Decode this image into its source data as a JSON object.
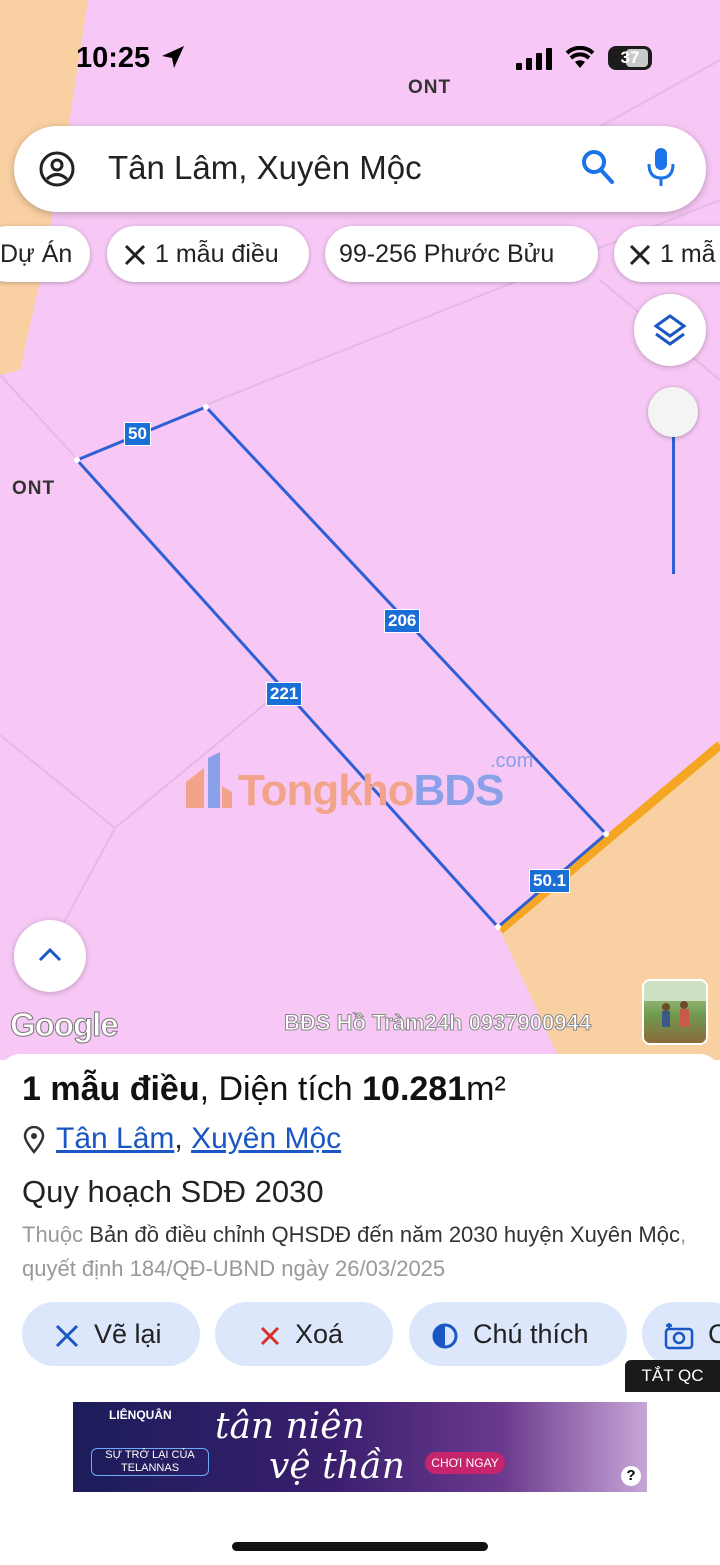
{
  "status_bar": {
    "time": "10:25",
    "battery": "37"
  },
  "map": {
    "zone_labels": [
      "ONT",
      "ONT"
    ],
    "search": {
      "query": "Tân Lâm, Xuyên Mộc"
    },
    "chips": [
      "Dự Án",
      "1 mẫu điều",
      "99-256 Phước Bửu",
      "1 mẫ"
    ],
    "edge_labels": [
      "50",
      "206",
      "221",
      "50.1"
    ],
    "watermark": {
      "text_a": "Tongkho",
      "text_b": "BDS",
      "suffix": ".com"
    },
    "google_logo": "Google",
    "overlay_text": "BĐS Hồ Tràm24h 0937900944",
    "colors": {
      "land_pink": "#f7c8f5",
      "land_orange": "#f9d0a2",
      "boundary": "#2f5fd4",
      "road": "#f5a623"
    }
  },
  "sheet": {
    "title_a": "1 mẫu điều",
    "title_b": ", Diện tích ",
    "title_area": "10.281",
    "title_unit": "m²",
    "location_a": "Tân Lâm",
    "location_sep": ",",
    "location_b": "Xuyên Mộc",
    "plan_title": "Quy hoạch SDĐ 2030",
    "desc_prefix": "Thuộc",
    "desc_main": "Bản đồ điều chỉnh QHSDĐ đến năm 2030 huyện Xuyên Mộc",
    "desc_suffix": ", quyết định 184/QĐ-UBND ngày 26/03/2025",
    "actions": [
      "Vẽ lại",
      "Xoá",
      "Chú thích",
      "C"
    ]
  },
  "ad": {
    "close_label": "TẮT QC",
    "brand": "LIÊNQUÂN",
    "sub": "SỰ TRỞ LẠI CỦA TELANNAS",
    "main_1": "tân niên",
    "main_2": "vệ thần",
    "cta": "CHƠI NGAY",
    "help": "?"
  }
}
